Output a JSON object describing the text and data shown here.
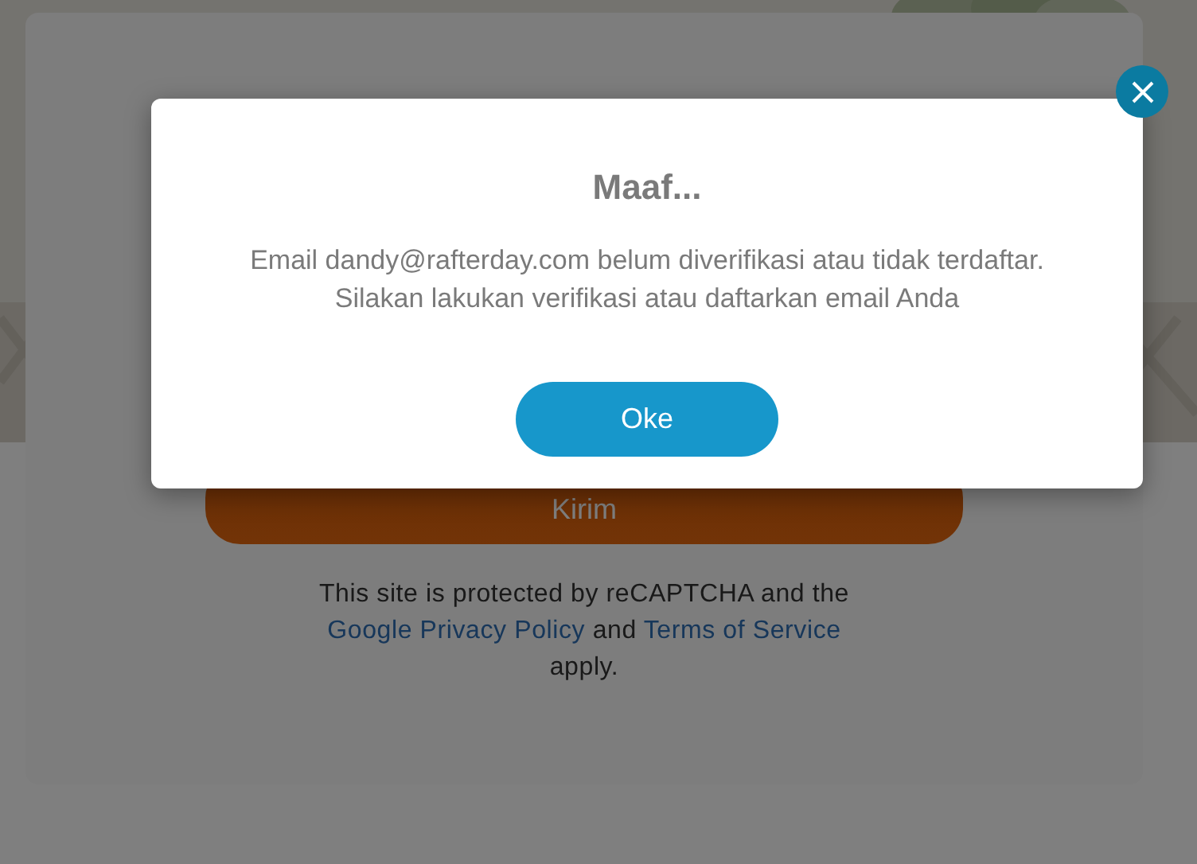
{
  "page": {
    "submit_button": "Kirim",
    "recaptcha_notice": {
      "text_before": "This site is protected by reCAPTCHA and the",
      "privacy_link": "Google Privacy Policy",
      "text_middle": "and",
      "terms_link": "Terms of Service",
      "text_after": "apply."
    }
  },
  "dialog": {
    "title": "Maaf...",
    "message_lines": [
      "Email dandy@rafterday.com belum diverifikasi atau tidak terdaftar.",
      "Silakan lakukan verifikasi atau daftarkan email Anda"
    ],
    "ok_button": "Oke"
  }
}
